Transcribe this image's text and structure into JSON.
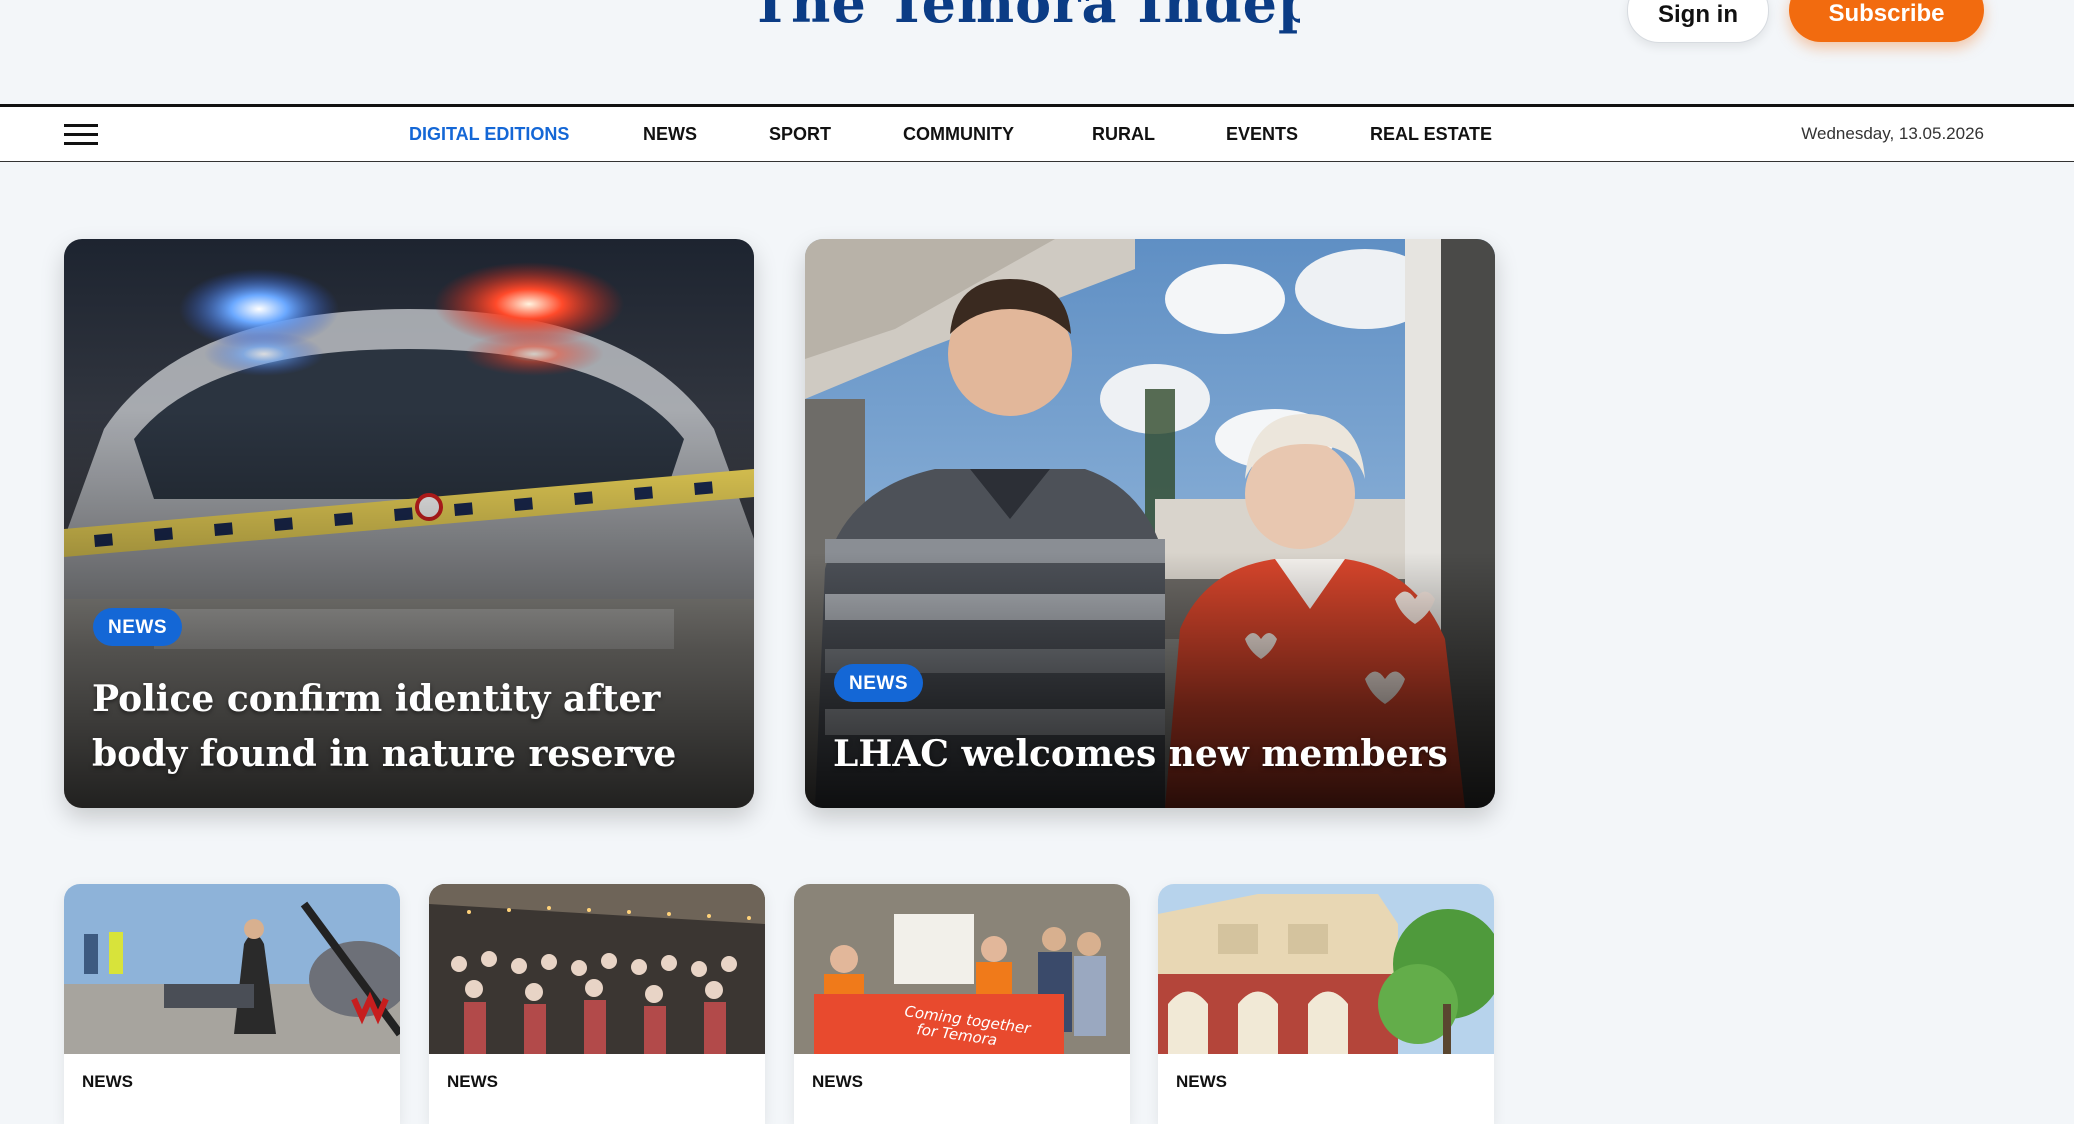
{
  "header": {
    "masthead": "The Temora Independent",
    "sign_in_label": "Sign in",
    "subscribe_label": "Subscribe"
  },
  "nav": {
    "items": [
      "DIGITAL EDITIONS",
      "NEWS",
      "SPORT",
      "COMMUNITY",
      "RURAL",
      "EVENTS",
      "REAL ESTATE"
    ],
    "active": "DIGITAL EDITIONS",
    "date": "Wednesday, 13.05.2026"
  },
  "featured": [
    {
      "category": "NEWS",
      "title": "Police confirm identity after body found in nature reserve"
    },
    {
      "category": "NEWS",
      "title": "LHAC welcomes new members"
    }
  ],
  "cards": [
    {
      "category": "NEWS"
    },
    {
      "category": "NEWS"
    },
    {
      "category": "NEWS",
      "image_text": [
        "Coming together",
        "for Temora"
      ]
    },
    {
      "category": "NEWS"
    }
  ],
  "colors": {
    "accent_blue": "#1467d6",
    "subscribe_orange": "#f26b0f",
    "masthead_blue": "#0b3c85",
    "page_background": "#f3f6f9"
  }
}
